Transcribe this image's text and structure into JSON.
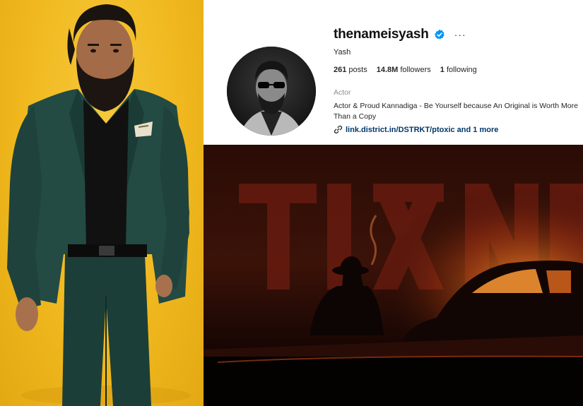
{
  "profile": {
    "username": "thenameisyash",
    "verified_icon": "verified-badge-icon",
    "more_icon": "more-options-icon",
    "more_label": "···",
    "full_name": "Yash",
    "stats": {
      "posts_count": "261",
      "posts_label": "posts",
      "followers_count": "14.8M",
      "followers_label": "followers",
      "following_count": "1",
      "following_label": "following"
    },
    "category": "Actor",
    "bio": "Actor & Proud Kannadiga - Be Yourself because An Original is Worth More Than a Copy",
    "link_text": "link.district.in/DSTRKT/ptoxic and 1 more"
  },
  "colors": {
    "left_background": "#f0b81e",
    "verified_blue": "#0095f6",
    "link_color": "#00376b",
    "poster_red": "#7a1a0e",
    "poster_glow": "#ff9a2a"
  }
}
